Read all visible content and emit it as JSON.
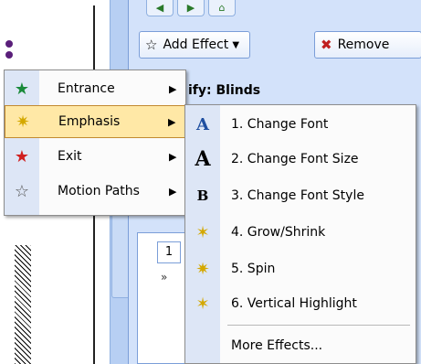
{
  "taskpane": {
    "add_effect_label": "Add Effect",
    "remove_label": "Remove",
    "modify_label": "ify: Blinds",
    "order_value": "1"
  },
  "menu_left": {
    "items": [
      {
        "label": "Entrance",
        "icon": "entrance-star-icon"
      },
      {
        "label": "Emphasis",
        "icon": "emphasis-star-icon"
      },
      {
        "label": "Exit",
        "icon": "exit-star-icon"
      },
      {
        "label": "Motion Paths",
        "icon": "motion-path-star-icon"
      }
    ]
  },
  "menu_right": {
    "items": [
      {
        "label": "1. Change Font",
        "icon": "font-A-icon"
      },
      {
        "label": "2. Change Font Size",
        "icon": "font-size-A-icon"
      },
      {
        "label": "3. Change Font Style",
        "icon": "font-bold-B-icon"
      },
      {
        "label": "4. Grow/Shrink",
        "icon": "grow-shrink-star-icon"
      },
      {
        "label": "5. Spin",
        "icon": "spin-star-icon"
      },
      {
        "label": "6. Vertical Highlight",
        "icon": "vertical-highlight-star-icon"
      },
      {
        "label": "More Effects...",
        "icon": ""
      }
    ]
  },
  "colors": {
    "task_pane_bg": "#d3e2fa",
    "menu_gutter": "#dde6f6",
    "highlight": "#ffe8a6",
    "highlight_border": "#c28a30"
  }
}
